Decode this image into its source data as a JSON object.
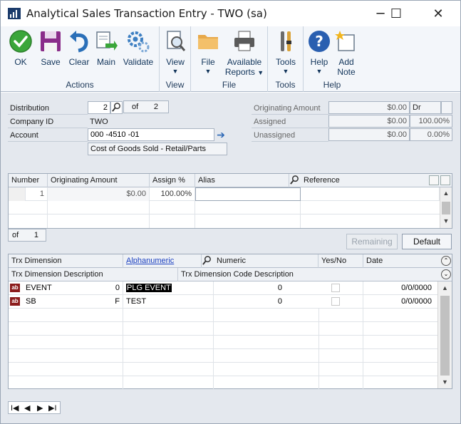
{
  "window": {
    "title": "Analytical Sales Transaction Entry  -  TWO (sa)",
    "minimize": "─",
    "maximize": "☐",
    "close": "✕"
  },
  "ribbon": {
    "groups": [
      {
        "label": "Actions",
        "buttons": [
          "OK",
          "Save",
          "Clear",
          "Main",
          "Validate"
        ]
      },
      {
        "label": "View",
        "buttons": [
          "View"
        ]
      },
      {
        "label": "File",
        "buttons": [
          "File",
          "Available Reports"
        ]
      },
      {
        "label": "Tools",
        "buttons": [
          "Tools"
        ]
      },
      {
        "label": "Help",
        "buttons": [
          "Help",
          "Add Note"
        ]
      }
    ],
    "available_reports_line1": "Available",
    "available_reports_line2": "Reports",
    "add_note_line1": "Add",
    "add_note_line2": "Note"
  },
  "header": {
    "distribution_label": "Distribution",
    "distribution_value": "2",
    "of_label": "of",
    "of_value": "2",
    "company_id_label": "Company ID",
    "company_id_value": "TWO",
    "account_label": "Account",
    "account_value": "000 -4510 -01",
    "account_description": "Cost of Goods Sold - Retail/Parts",
    "originating_amount_label": "Originating Amount",
    "originating_amount_value": "$0.00",
    "originating_amount_type": "Dr",
    "assigned_label": "Assigned",
    "assigned_value": "$0.00",
    "assigned_pct": "100.00%",
    "unassigned_label": "Unassigned",
    "unassigned_value": "$0.00",
    "unassigned_pct": "0.00%"
  },
  "assign_grid": {
    "columns": [
      "Number",
      "Originating Amount",
      "Assign %",
      "Alias",
      "Reference"
    ],
    "rows": [
      {
        "number": "1",
        "amount": "$0.00",
        "assign": "100.00%",
        "alias": "",
        "reference": ""
      }
    ],
    "of_label": "of",
    "of_value": "1"
  },
  "buttons": {
    "remaining": "Remaining",
    "default": "Default"
  },
  "dim_grid": {
    "col_trx_dimension": "Trx Dimension",
    "col_alphanumeric": "Alphanumeric",
    "col_numeric": "Numeric",
    "col_yes_no": "Yes/No",
    "col_date": "Date",
    "col_desc": "Trx Dimension Description",
    "col_code_desc": "Trx Dimension Code Description",
    "rows": [
      {
        "icon": "ab",
        "dimension": "EVENT",
        "type": "0",
        "alpha": "PLG EVENT",
        "numeric": "0",
        "date": "0/0/0000"
      },
      {
        "icon": "ab",
        "dimension": "SB",
        "type": "F",
        "alpha": "TEST",
        "numeric": "0",
        "date": "0/0/0000"
      }
    ]
  },
  "nav": {
    "first": "I◀",
    "prev": "◀",
    "next": "▶",
    "last": "▶I"
  }
}
